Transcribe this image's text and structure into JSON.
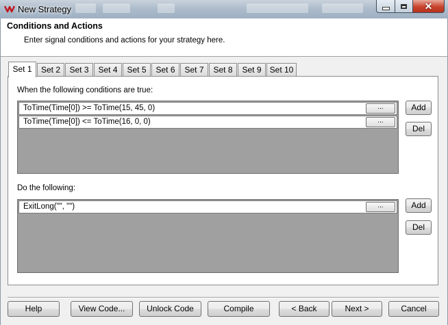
{
  "window": {
    "title": "New Strategy",
    "close_glyph": "✕"
  },
  "header": {
    "title": "Conditions and Actions",
    "subtitle": "Enter signal conditions and actions for your strategy here."
  },
  "tabs": [
    {
      "label": "Set 1",
      "active": true
    },
    {
      "label": "Set 2"
    },
    {
      "label": "Set 3"
    },
    {
      "label": "Set 4"
    },
    {
      "label": "Set 5"
    },
    {
      "label": "Set 6"
    },
    {
      "label": "Set 7"
    },
    {
      "label": "Set 8"
    },
    {
      "label": "Set 9"
    },
    {
      "label": "Set 10"
    }
  ],
  "conditions": {
    "label": "When the following conditions are true:",
    "rows": [
      {
        "text": "ToTime(Time[0]) >= ToTime(15, 45, 0)",
        "button": "..."
      },
      {
        "text": "ToTime(Time[0]) <= ToTime(16, 0, 0)",
        "button": "..."
      }
    ],
    "add_label": "Add",
    "del_label": "Del"
  },
  "actions": {
    "label": "Do the following:",
    "rows": [
      {
        "text": "ExitLong(\"\", \"\")",
        "button": "..."
      }
    ],
    "add_label": "Add",
    "del_label": "Del"
  },
  "footer": {
    "help": "Help",
    "view_code": "View Code...",
    "unlock_code": "Unlock Code",
    "compile": "Compile",
    "back": "< Back",
    "next": "Next >",
    "cancel": "Cancel"
  },
  "colors": {
    "list_background": "#a0a0a0",
    "header_background": "#ffffff",
    "close_button": "#c8432c"
  }
}
